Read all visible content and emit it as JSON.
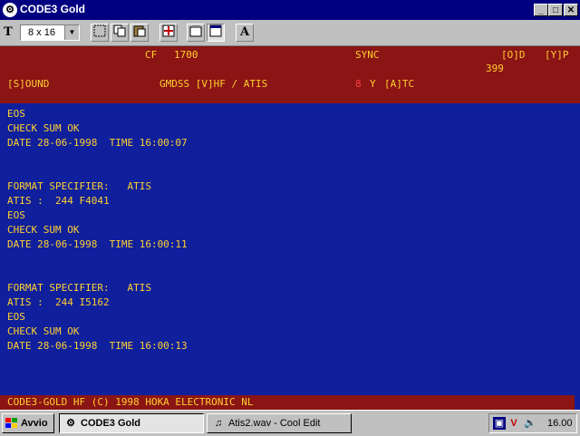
{
  "window": {
    "title": "CODE3 Gold",
    "minimize_glyph": "_",
    "maximize_glyph": "□",
    "close_glyph": "✕"
  },
  "toolbar": {
    "font_size_value": "8 x 16",
    "font_icon_glyph": "T",
    "text_button_glyph": "A"
  },
  "status_panel": {
    "cf_label": "CF",
    "cf_value": "1700",
    "sync": "SYNC",
    "od": "[O]D",
    "yp": "[Y]P",
    "count": "399",
    "sound": "[S]OUND",
    "mode": "GMDSS [V]HF / ATIS",
    "indicator": "8",
    "y_flag": "Y",
    "atc": "[A]TC"
  },
  "log": [
    "EOS",
    "CHECK SUM OK",
    "DATE 28-06-1998  TIME 16:00:07",
    "",
    "",
    "FORMAT SPECIFIER:   ATIS",
    "ATIS :  244 F4041",
    "EOS",
    "CHECK SUM OK",
    "DATE 28-06-1998  TIME 16:00:11",
    "",
    "",
    "FORMAT SPECIFIER:   ATIS",
    "ATIS :  244 I5162",
    "EOS",
    "CHECK SUM OK",
    "DATE 28-06-1998  TIME 16:00:13"
  ],
  "footer_banner": "CODE3-GOLD HF (C) 1998 HOKA ELECTRONIC NL",
  "taskbar": {
    "start_label": "Avvio",
    "tasks": [
      {
        "label": "CODE3 Gold",
        "active": true
      },
      {
        "label": "Atis2.wav - Cool Edit",
        "active": false
      }
    ],
    "clock": "16.00"
  },
  "colors": {
    "terminal_bg": "#10209c",
    "panel_bg": "#8b1414",
    "text_yellow": "#ffd030",
    "title_bar": "#000080"
  }
}
